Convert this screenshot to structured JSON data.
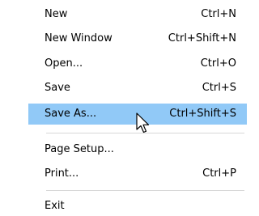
{
  "menu": {
    "items": [
      {
        "label": "New",
        "shortcut": "Ctrl+N"
      },
      {
        "label": "New Window",
        "shortcut": "Ctrl+Shift+N"
      },
      {
        "label": "Open...",
        "shortcut": "Ctrl+O"
      },
      {
        "label": "Save",
        "shortcut": "Ctrl+S"
      },
      {
        "label": "Save As...",
        "shortcut": "Ctrl+Shift+S"
      },
      {
        "label": "Page Setup...",
        "shortcut": ""
      },
      {
        "label": "Print...",
        "shortcut": "Ctrl+P"
      },
      {
        "label": "Exit",
        "shortcut": ""
      }
    ],
    "highlighted_item": "Save As...",
    "highlight_color": "#91c9f7",
    "separator_color": "#d7d7d7"
  },
  "cursor": {
    "icon": "arrow-pointer-icon"
  }
}
